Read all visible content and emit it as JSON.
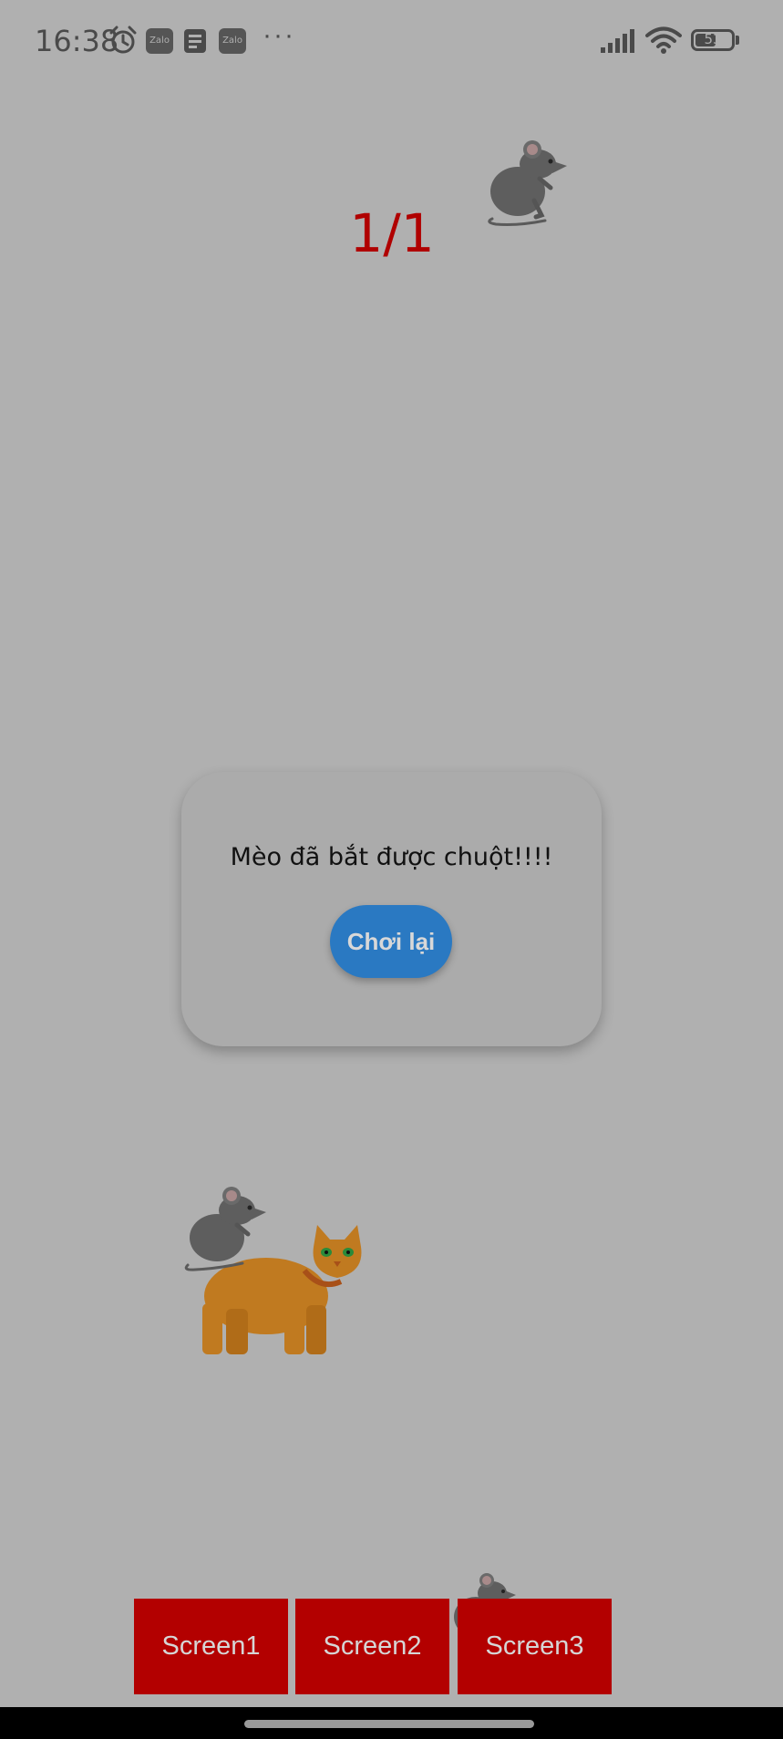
{
  "status_bar": {
    "time": "16:38",
    "notification_badges": [
      "Zalo",
      "Zalo"
    ],
    "overflow": "···",
    "battery": "53",
    "battery_level": 0.53,
    "icons": [
      "alarm-icon",
      "zalo-icon",
      "news-icon",
      "zalo-icon",
      "more-icon",
      "signal-icon",
      "wifi-icon",
      "battery-icon"
    ]
  },
  "game": {
    "score": "1/1",
    "score_color": "#b00000",
    "sprites": [
      "mouse",
      "mouse",
      "cat",
      "mouse"
    ]
  },
  "dialog": {
    "message": "Mèo đã bắt được chuột!!!!",
    "replay_label": "Chơi lại",
    "button_color": "#2a79c2"
  },
  "nav": {
    "buttons": [
      "Screen1",
      "Screen2",
      "Screen3"
    ],
    "button_color": "#b30000"
  }
}
